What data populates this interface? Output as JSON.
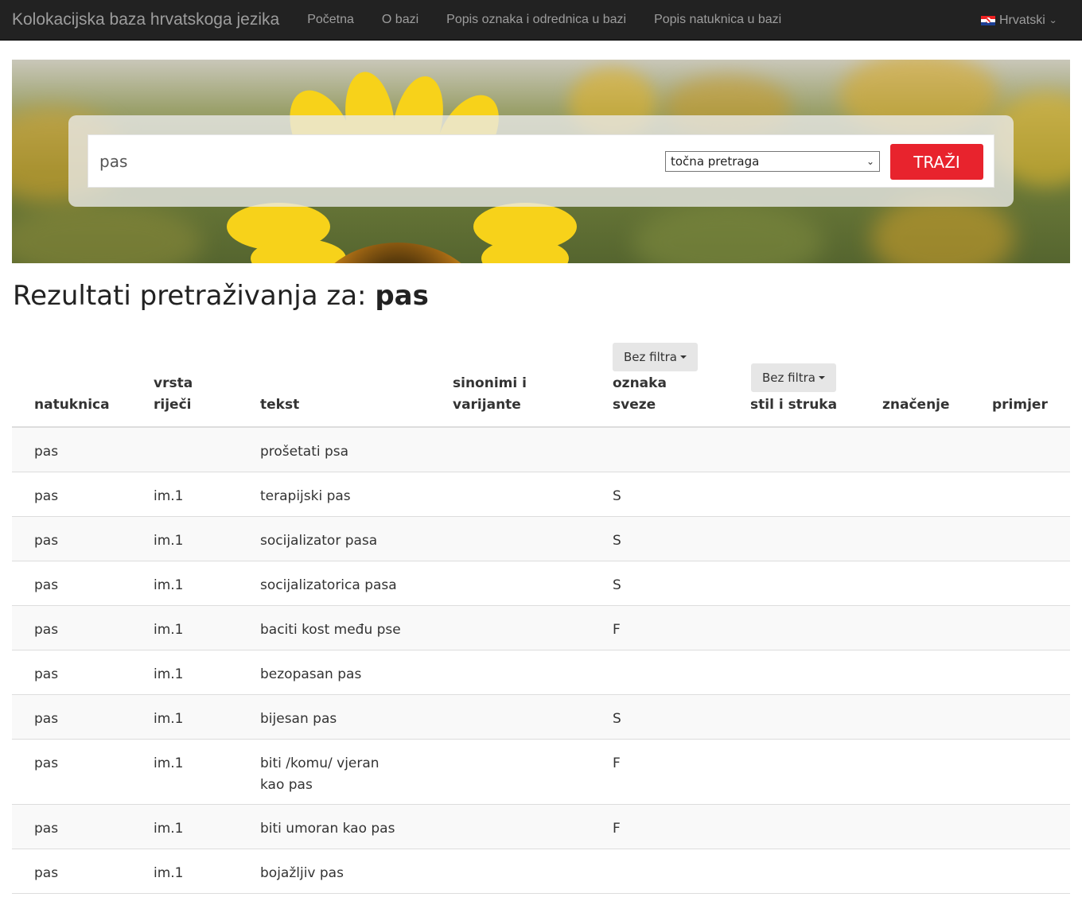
{
  "navbar": {
    "brand": "Kolokacijska baza hrvatskoga jezika",
    "items": [
      "Početna",
      "O bazi",
      "Popis oznaka i odrednica u bazi",
      "Popis natuknica u bazi"
    ],
    "language": "Hrvatski"
  },
  "search": {
    "query": "pas",
    "mode": "točna pretraga",
    "button": "TRAŽI"
  },
  "results": {
    "title_prefix": "Rezultati pretraživanja za:",
    "title_term": "pas"
  },
  "table": {
    "headers": {
      "natuknica": "natuknica",
      "vrsta_line1": "vrsta",
      "vrsta_line2": "riječi",
      "tekst": "tekst",
      "sinonimi_line1": "sinonimi i",
      "sinonimi_line2": "varijante",
      "oznaka_line1": "oznaka",
      "oznaka_line2": "sveze",
      "stil": "stil i struka",
      "znacenje": "značenje",
      "primjer": "primjer"
    },
    "filter_oznaka": "Bez filtra",
    "filter_stil": "Bez filtra",
    "rows": [
      {
        "natuknica": "pas",
        "vrsta": "",
        "tekst": "prošetati psa",
        "oznaka": ""
      },
      {
        "natuknica": "pas",
        "vrsta": "im.1",
        "tekst": "terapijski pas",
        "oznaka": "S"
      },
      {
        "natuknica": "pas",
        "vrsta": "im.1",
        "tekst": "socijalizator pasa",
        "oznaka": "S"
      },
      {
        "natuknica": "pas",
        "vrsta": "im.1",
        "tekst": "socijalizatorica pasa",
        "oznaka": "S"
      },
      {
        "natuknica": "pas",
        "vrsta": "im.1",
        "tekst": "baciti kost među pse",
        "oznaka": "F"
      },
      {
        "natuknica": "pas",
        "vrsta": "im.1",
        "tekst": "bezopasan pas",
        "oznaka": ""
      },
      {
        "natuknica": "pas",
        "vrsta": "im.1",
        "tekst": "bijesan pas",
        "oznaka": "S"
      },
      {
        "natuknica": "pas",
        "vrsta": "im.1",
        "tekst": "biti /komu/ vjeran kao pas",
        "oznaka": "F"
      },
      {
        "natuknica": "pas",
        "vrsta": "im.1",
        "tekst": "biti umoran kao pas",
        "oznaka": "F"
      },
      {
        "natuknica": "pas",
        "vrsta": "im.1",
        "tekst": "bojažljiv pas",
        "oznaka": ""
      }
    ]
  },
  "colors": {
    "navbar_bg": "#222222",
    "nav_text": "#9d9d9d",
    "search_button": "#e8232d",
    "row_stripe": "#f9f9f9"
  }
}
